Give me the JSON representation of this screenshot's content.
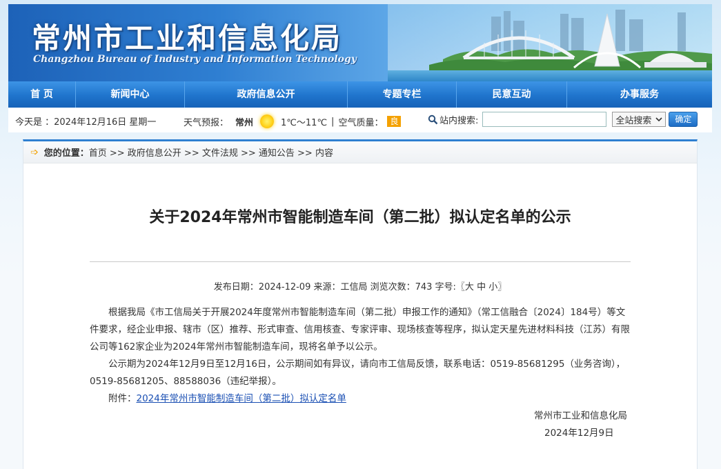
{
  "site": {
    "title": "常州市工业和信息化局",
    "subtitle": "Changzhou Bureau of Industry and Information Technology"
  },
  "nav": {
    "items": [
      "首 页",
      "新闻中心",
      "政府信息公开",
      "专题专栏",
      "民意互动",
      "办事服务"
    ]
  },
  "infobar": {
    "date_text": "今天是 ：2024年12月16日 星期一",
    "weather_label": "天气预报：",
    "city": "常州",
    "temp": "1℃～11℃",
    "sep": "|",
    "air_label": "空气质量：",
    "air_value": "良",
    "search_label": "站内搜索:",
    "search_placeholder": "",
    "scope_option": "全站搜索",
    "submit_label": "确定"
  },
  "breadcrumb": {
    "prefix": "您的位置：",
    "path": "首页 >> 政府信息公开 >> 文件法规 >> 通知公告 >> 内容"
  },
  "article": {
    "title": "关于2024年常州市智能制造车间（第二批）拟认定名单的公示",
    "meta": "发布日期：2024-12-09  来源：工信局  浏览次数：743  字号:〖大 中 小〗",
    "para1": "根据我局《市工信局关于开展2024年度常州市智能制造车间（第二批）申报工作的通知》（常工信融合〔2024〕184号）等文件要求，经企业申报、辖市（区）推荐、形式审查、信用核查、专家评审、现场核查等程序，拟认定天星先进材料科技（江苏）有限公司等162家企业为2024年常州市智能制造车间，现将名单予以公示。",
    "para2": "公示期为2024年12月9日至12月16日，公示期间如有异议，请向市工信局反馈，联系电话：0519-85681295（业务咨询），0519-85681205、88588036（违纪举报）。",
    "attach_label": "附件：",
    "attach_link": "2024年常州市智能制造车间（第二批）拟认定名单",
    "signer": "常州市工业和信息化局",
    "sign_date": "2024年12月9日"
  },
  "colors": {
    "nav_blue": "#1f74cc",
    "accent_orange": "#f4a100",
    "link_blue": "#1a4fb3"
  }
}
